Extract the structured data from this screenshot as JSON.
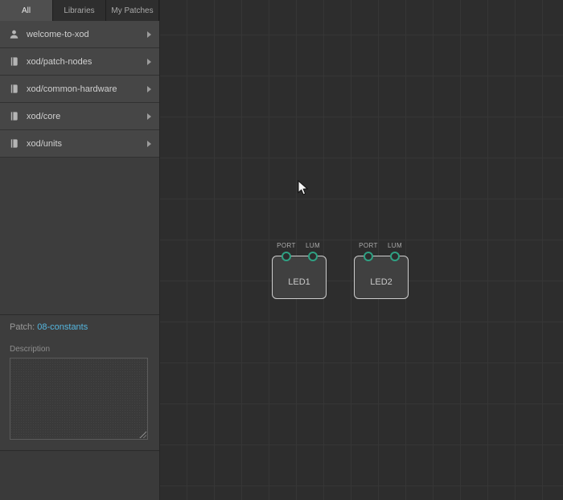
{
  "browser": {
    "tabs": [
      {
        "label": "All",
        "active": true
      },
      {
        "label": "Libraries",
        "active": false
      },
      {
        "label": "My Patches",
        "active": false
      }
    ],
    "items": [
      {
        "label": "welcome-to-xod",
        "icon": "user-icon"
      },
      {
        "label": "xod/patch-nodes",
        "icon": "book-icon"
      },
      {
        "label": "xod/common-hardware",
        "icon": "book-icon"
      },
      {
        "label": "xod/core",
        "icon": "book-icon"
      },
      {
        "label": "xod/units",
        "icon": "book-icon"
      }
    ]
  },
  "patch_info": {
    "label": "Patch:",
    "name": "08-constants",
    "description_label": "Description",
    "description_value": ""
  },
  "canvas": {
    "nodes": [
      {
        "label": "LED1",
        "pins": [
          "PORT",
          "LUM"
        ]
      },
      {
        "label": "LED2",
        "pins": [
          "PORT",
          "LUM"
        ]
      }
    ]
  },
  "colors": {
    "pin_outline": "#2fa183",
    "patch_link": "#55b7e0",
    "node_border": "#cdcdcd"
  }
}
